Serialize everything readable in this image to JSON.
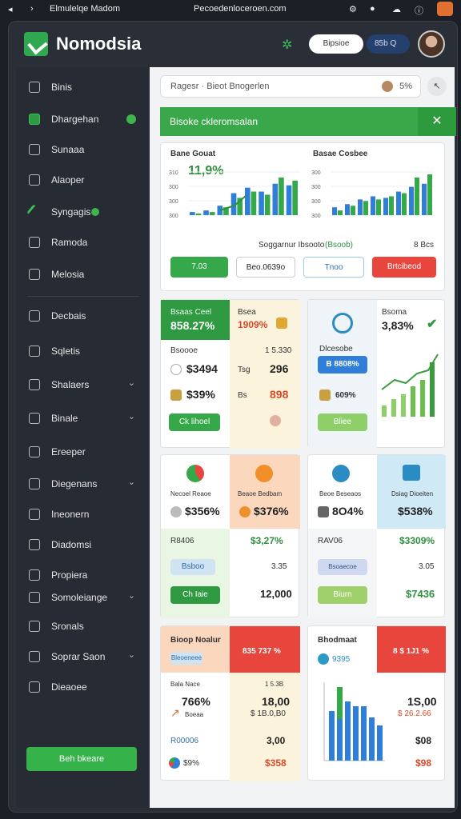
{
  "statusbar": {
    "left_title": "Elmulelqe Madom",
    "url": "Pecoedenloceroen.com"
  },
  "header": {
    "brand": "Nomodsia",
    "pill": "Bipsioe",
    "search": "85b Q"
  },
  "sidebar": {
    "items": [
      {
        "label": "Binis",
        "icon": "feather-icon"
      },
      {
        "label": "Dhargehan",
        "icon": "inbox-icon",
        "badge": true
      },
      {
        "label": "Sunaaa",
        "icon": "settings-icon"
      },
      {
        "label": "Alaoper",
        "icon": "grid-icon"
      },
      {
        "label": "Syngagis",
        "icon": "pen-icon",
        "badge": true
      },
      {
        "label": "Ramoda",
        "icon": "image-icon"
      },
      {
        "label": "Melosia",
        "icon": "link-icon"
      },
      {
        "label": "Decbais",
        "icon": "doc-icon"
      },
      {
        "label": "Sqletis",
        "icon": "globe-icon"
      },
      {
        "label": "Shalaers",
        "icon": "box-icon",
        "chevron": true
      },
      {
        "label": "Binale",
        "icon": "image-icon",
        "chevron": true
      },
      {
        "label": "Ereeper",
        "icon": "edit-icon"
      },
      {
        "label": "Diegenans",
        "icon": "shield-icon",
        "chevron": true
      },
      {
        "label": "Ineonern",
        "icon": "user-icon"
      },
      {
        "label": "Diadomsi",
        "icon": "window-icon"
      },
      {
        "label": "Propiera",
        "icon": "table-icon"
      },
      {
        "label": "Somoleiange",
        "icon": "folder-icon",
        "chevron": true
      },
      {
        "label": "Sronals",
        "icon": "columns-icon"
      },
      {
        "label": "Soprar Saon",
        "icon": "pin-icon",
        "chevron": true
      },
      {
        "label": "Dieaoee",
        "icon": "disk-icon"
      }
    ],
    "cta": "Beh bkeare"
  },
  "main": {
    "search_placeholder": "Ragesr · Bieot Bnogerlen",
    "search_value": "5%",
    "banner": "Bisoke ckleromsalan",
    "chart_panel": {
      "left_title": "Bane Gouat",
      "left_value": "11,9%",
      "right_title": "Basae Cosbee",
      "caption": "Soggarnur Ibsooto",
      "caption_green": "(Bsoob)",
      "caption_value": "8 Bcs",
      "chips": [
        "7.03",
        "Beo.0639o",
        "Tnoo",
        "Brtcibeod"
      ]
    },
    "kpi_a": {
      "head_left": "Bsaas Ceel",
      "head_left_value": "858.27%",
      "head_right": "Bsea",
      "head_right_value": "1909%",
      "sub": "Bsoooe",
      "sub_right": "1 5.330",
      "r1a": "$3494",
      "r1b": "Tsg",
      "r1c": "296",
      "r2a": "$39%",
      "r2b": "Bs",
      "r2c": "898",
      "btn": "Ck lihoel"
    },
    "kpi_b": {
      "head": "Bsoma",
      "head_value": "3,83%",
      "sub": "Dlcesobe",
      "pill": "B 8808%",
      "r2": "609%",
      "btn": "Bliee"
    },
    "kpi_c": {
      "l1": "Necoel Reaoe",
      "l1v": "$356%",
      "r1": "Beaoe Bedbam",
      "r1v": "$376%",
      "row1": "R8406",
      "row1v": "$3,27%",
      "row2": "Bsboo",
      "row2v": "3.35",
      "btn": "Ch Iaie",
      "btnv": "12,000"
    },
    "kpi_d": {
      "l1": "Beoe Beseaos",
      "l1v": "8O4%",
      "r1": "Dsiag Dioeiten",
      "r1v": "$538%",
      "row1": "RAV06",
      "row1v": "$3309%",
      "row2": "Bsoaecoe",
      "row2v": "3.05",
      "btn": "Biurn",
      "btnv": "$7436"
    },
    "kpi_e": {
      "head": "Bioop Noalur",
      "head_value": "835 737 %",
      "sub": "Bleoeneee",
      "mid": "Bala Nace",
      "mid_r": "1 5.3B",
      "big": "766%",
      "big_r": "18,00",
      "small": "Boeaa",
      "small_r": "$ 1B.0,B0",
      "row": "R00006",
      "row_r": "3,00",
      "foot": "$9%",
      "foot_r": "$358"
    },
    "kpi_f": {
      "head": "Bhodmaat",
      "head_value": "8 $ 1J1 %",
      "sub": "9395",
      "big": "1S,00",
      "small": "$ 26.2.66",
      "row_r": "$08",
      "foot_r": "$98"
    }
  },
  "chart_data": [
    {
      "type": "bar",
      "title": "Bane Gouat",
      "categories": [
        "",
        "",
        "",
        "",
        "",
        "",
        "",
        ""
      ],
      "series": [
        {
          "values": [
            4,
            6,
            12,
            28,
            35,
            30,
            40,
            38
          ]
        },
        {
          "values": [
            2,
            4,
            10,
            22,
            30,
            26,
            48,
            44
          ]
        }
      ],
      "ylim": [
        0,
        55
      ],
      "yticks": [
        "310",
        "300",
        "300",
        "300"
      ]
    },
    {
      "type": "bar",
      "title": "Basae Cosbee",
      "categories": [
        "",
        "",
        "",
        "",
        "",
        "",
        "",
        ""
      ],
      "series": [
        {
          "values": [
            10,
            14,
            20,
            24,
            22,
            30,
            36,
            40
          ]
        },
        {
          "values": [
            6,
            12,
            18,
            20,
            24,
            28,
            48,
            52
          ]
        }
      ],
      "ylim": [
        0,
        55
      ],
      "yticks": [
        "300",
        "300",
        "300",
        "300"
      ]
    }
  ],
  "colors": {
    "accent": "#35b24a",
    "blue": "#2f7ed8",
    "red": "#e8453c",
    "peach": "#fbd7be"
  }
}
